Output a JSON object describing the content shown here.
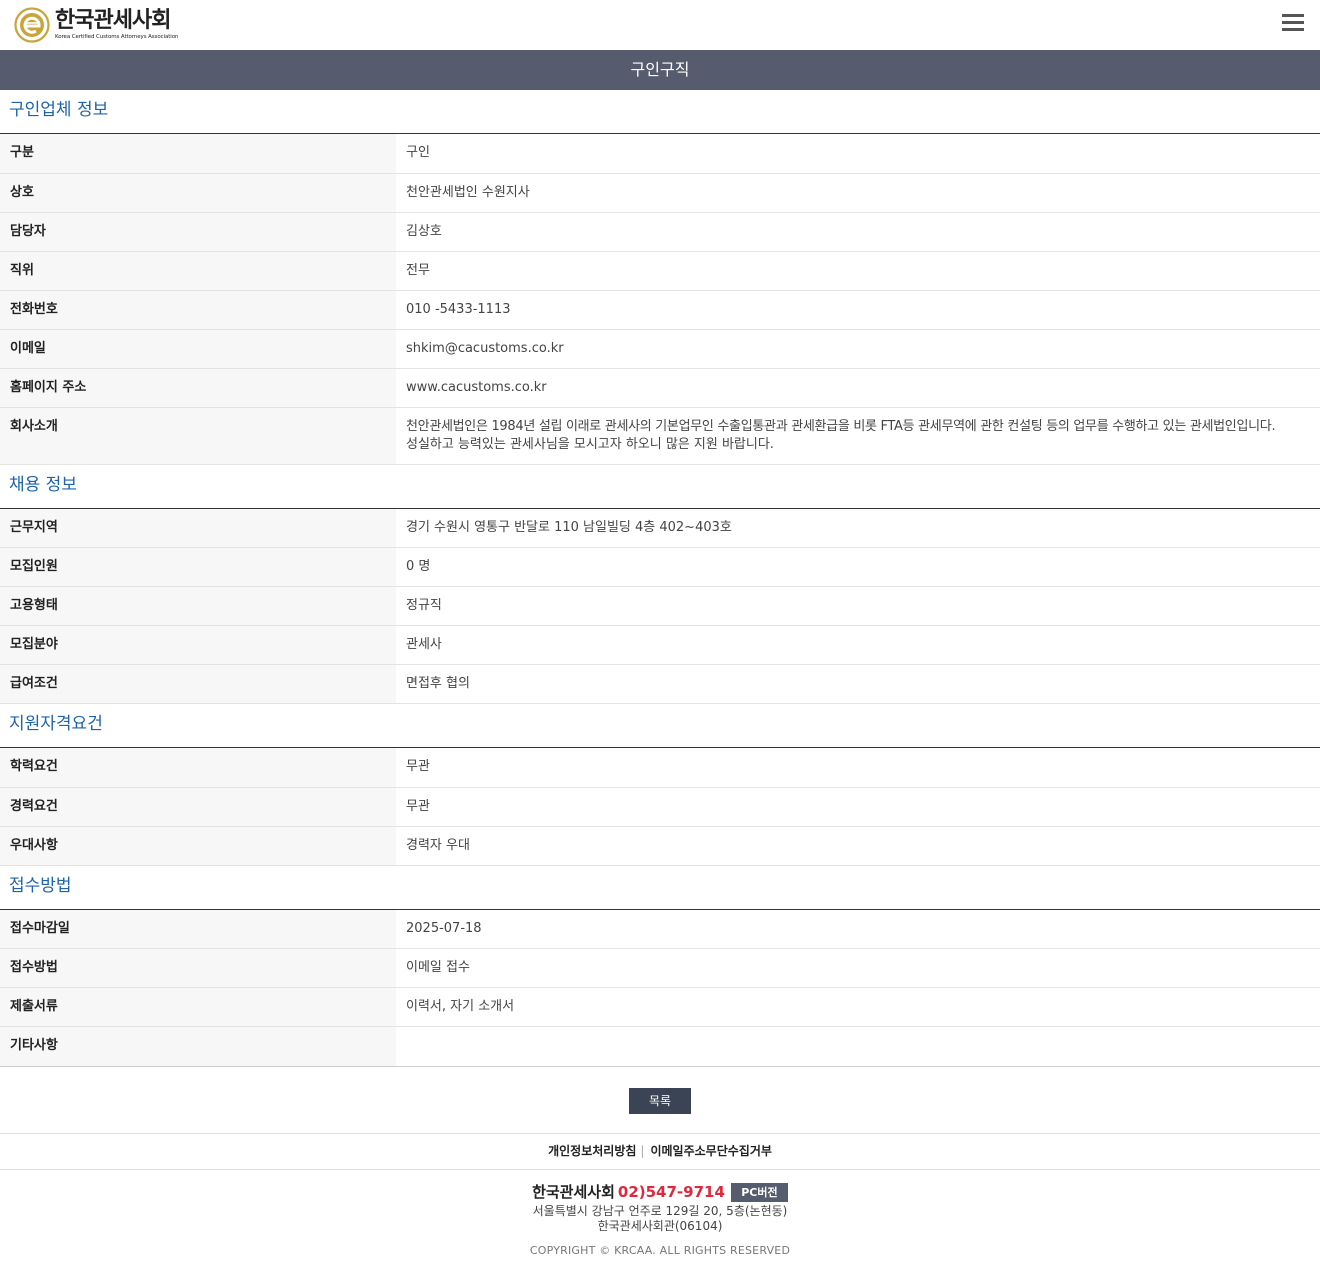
{
  "header": {
    "logo_title": "한국관세사회",
    "logo_subtitle": "Korea Certified Customs Attorneys Association",
    "menu_icon": "hamburger-menu-icon"
  },
  "page_title": "구인구직",
  "sections": {
    "company": {
      "title": "구인업체 정보",
      "rows": [
        {
          "label": "구분",
          "value": "구인"
        },
        {
          "label": "상호",
          "value": "천안관세법인 수원지사"
        },
        {
          "label": "담당자",
          "value": "김상호"
        },
        {
          "label": "직위",
          "value": "전무"
        },
        {
          "label": "전화번호",
          "value": "010 -5433-1113"
        },
        {
          "label": "이메일",
          "value": "shkim@cacustoms.co.kr"
        },
        {
          "label": "홈페이지 주소",
          "value": "www.cacustoms.co.kr"
        },
        {
          "label": "회사소개",
          "value": "천안관세법인은 1984년 설립 이래로 관세사의 기본업무인 수출입통관과 관세환급을 비롯 FTA등 관세무역에 관한 컨설팅 등의 업무를 수행하고 있는 관세법인입니다.",
          "value2": "성실하고 능력있는 관세사님을 모시고자 하오니 많은 지원 바랍니다."
        }
      ]
    },
    "recruit": {
      "title": "채용 정보",
      "rows": [
        {
          "label": "근무지역",
          "value": "경기 수원시 영통구 반달로 110 남일빌딩 4층 402~403호"
        },
        {
          "label": "모집인원",
          "value": "0 명"
        },
        {
          "label": "고용형태",
          "value": "정규직"
        },
        {
          "label": "모집분야",
          "value": "관세사"
        },
        {
          "label": "급여조건",
          "value": "면접후 협의"
        }
      ]
    },
    "qualify": {
      "title": "지원자격요건",
      "rows": [
        {
          "label": "학력요건",
          "value": "무관"
        },
        {
          "label": "경력요건",
          "value": "무관"
        },
        {
          "label": "우대사항",
          "value": "경력자 우대"
        }
      ]
    },
    "apply": {
      "title": "접수방법",
      "rows": [
        {
          "label": "접수마감일",
          "value": "2025-07-18"
        },
        {
          "label": "접수방법",
          "value": "이메일 접수"
        },
        {
          "label": "제출서류",
          "value": "이력서, 자기 소개서"
        },
        {
          "label": "기타사항",
          "value": ""
        }
      ]
    }
  },
  "list_button": "목록",
  "footer": {
    "links": [
      "개인정보처리방침",
      "이메일주소무단수집거부"
    ],
    "separator": "|",
    "org_name": "한국관세사회",
    "tel": "02)547-9714",
    "pc_button": "PC버전",
    "address1": "서울특별시 강남구 언주로 129길 20, 5층(논현동)",
    "address2": "한국관세사회관(06104)",
    "copyright": "COPYRIGHT © KRCAA. ALL RIGHTS RESERVED"
  },
  "colors": {
    "title_bar": "#565c6d",
    "section_title": "#1d63ad",
    "tel": "#e0283c",
    "button": "#3b4454",
    "logo_gold": "#c9a43a"
  }
}
